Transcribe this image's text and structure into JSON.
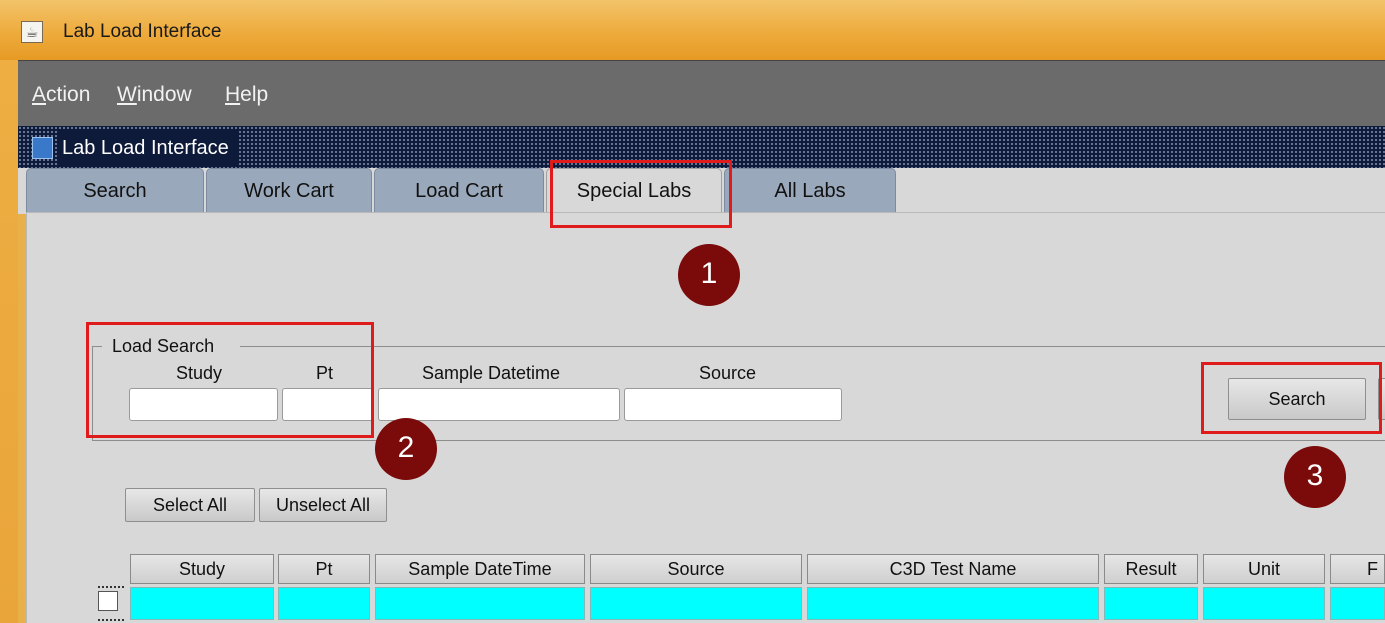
{
  "window": {
    "title": "Lab Load Interface",
    "app_icon": "java-cup-icon"
  },
  "menu": {
    "items": [
      "Action",
      "Window",
      "Help"
    ]
  },
  "internal_frame": {
    "title": "Lab Load Interface",
    "icon": "frame-icon"
  },
  "tabs": [
    "Search",
    "Work Cart",
    "Load Cart",
    "Special Labs",
    "All Labs"
  ],
  "active_tab": "Special Labs",
  "load_search": {
    "group_title": "Load Search",
    "study_label": "Study",
    "pt_label": "Pt",
    "sample_datetime_label": "Sample Datetime",
    "source_label": "Source",
    "study_value": "",
    "pt_value": "",
    "sample_datetime_value": "",
    "source_value": "",
    "search_button": "Search"
  },
  "selection": {
    "select_all": "Select All",
    "unselect_all": "Unselect All"
  },
  "table": {
    "columns": [
      "Study",
      "Pt",
      "Sample DateTime",
      "Source",
      "C3D Test Name",
      "Result",
      "Unit",
      "F"
    ]
  },
  "annotations": {
    "badges": [
      "1",
      "2",
      "3"
    ],
    "color": "#e01b1b",
    "badge_color": "#7b0a0a"
  }
}
